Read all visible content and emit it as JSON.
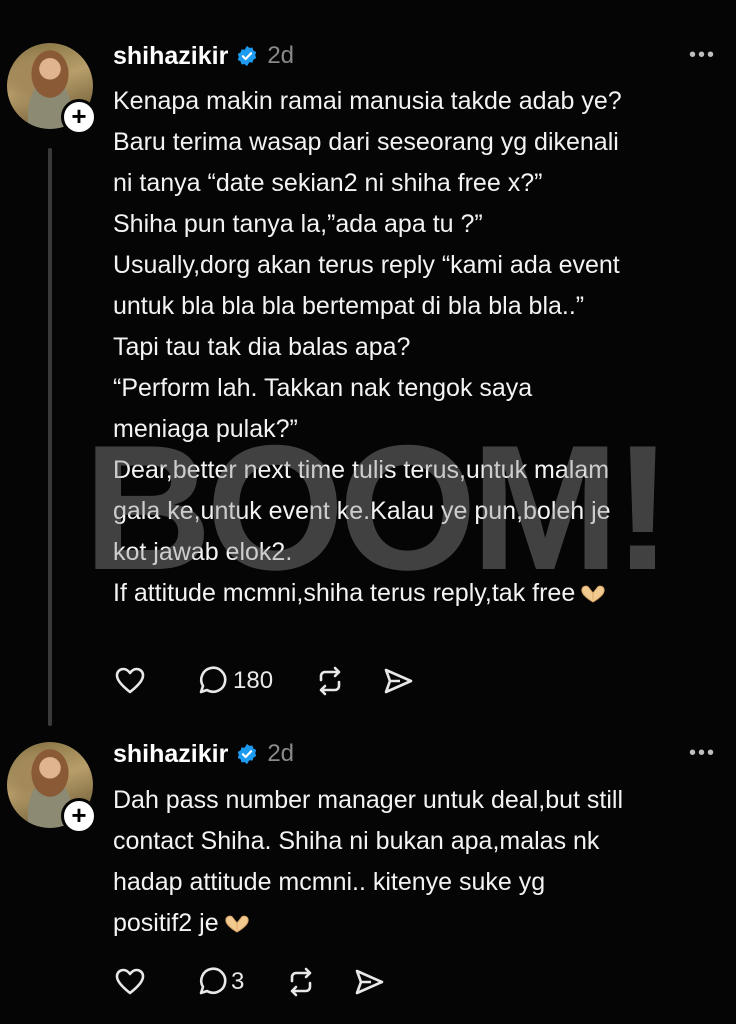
{
  "posts": [
    {
      "username": "shihazikir",
      "time": "2d",
      "more": "•••",
      "lines": [
        "Kenapa makin ramai manusia takde adab ye?",
        "Baru terima wasap dari seseorang yg dikenali",
        "ni tanya “date sekian2 ni shiha free x?”",
        "Shiha pun tanya la,”ada apa tu ?”",
        "Usually,dorg akan terus reply “kami ada event",
        "untuk bla bla bla bertempat di bla bla bla..”",
        "Tapi tau tak dia balas apa?",
        "“Perform lah. Takkan nak tengok saya",
        "meniaga pulak?”",
        "Dear,better next time tulis terus,untuk malam",
        "gala ke,untuk event ke.Kalau ye pun,boleh je",
        "kot jawab elok2.",
        "If attitude mcmni,shiha terus reply,tak free"
      ],
      "reply_count": "180",
      "repost_count": ""
    },
    {
      "username": "shihazikir",
      "time": "2d",
      "more": "•••",
      "lines": [
        "Dah pass number manager untuk deal,but still",
        "contact Shiha. Shiha ni bukan apa,malas nk",
        "hadap attitude mcmni.. kitenye suke yg",
        "positif2 je"
      ],
      "reply_count": "3",
      "repost_count": ""
    }
  ],
  "watermark": "BOOM!",
  "colors": {
    "background": "#050505",
    "verified": "#1d9bf0",
    "muted": "#8a8a8a",
    "emoji": "#f2c98e"
  },
  "icons": [
    "heart-icon",
    "reply-icon",
    "repost-icon",
    "share-icon",
    "verified-icon",
    "plus-icon",
    "more-icon",
    "heart-hands-emoji"
  ]
}
